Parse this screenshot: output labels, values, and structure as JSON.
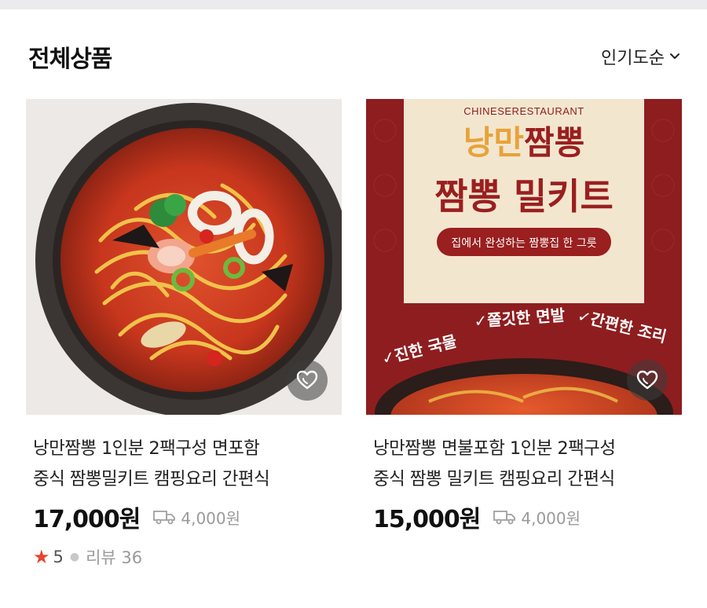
{
  "section": {
    "title": "전체상품",
    "sort_label": "인기도순"
  },
  "products": [
    {
      "name_line1": "낭만짬뽕 1인분 2팩구성 면포함",
      "name_line2": "중식 짬뽕밀키트 캠핑요리 간편식",
      "price": "17,000원",
      "shipping": "4,000원",
      "rating": "5",
      "review_label": "리뷰 36"
    },
    {
      "name_line1": "낭만짬뽕 면불포함 1인분 2팩구성",
      "name_line2": "중식 짬뽕 밀키트 캠핑요리 간편식",
      "price": "15,000원",
      "shipping": "4,000원",
      "banner": {
        "subtitle": "CHINESERESTAURANT",
        "title_part1": "낭만",
        "title_part2": "짬뽕",
        "title_line2": "짬뽕 밀키트",
        "tagline": "집에서 완성하는 짬뽕집 한 그릇",
        "feature1": "✓진한 국물",
        "feature2": "✓쫄깃한 면발",
        "feature3": "✓간편한 조리"
      }
    }
  ],
  "colors": {
    "banner_red": "#8e1d1f",
    "banner_cream": "#f3e6cf",
    "banner_gold": "#e7a33a",
    "star": "#e6452f"
  },
  "icons": {
    "sort": "chevron-down-icon",
    "wishlist": "heart-icon",
    "shipping": "truck-icon",
    "rating": "star-icon"
  }
}
